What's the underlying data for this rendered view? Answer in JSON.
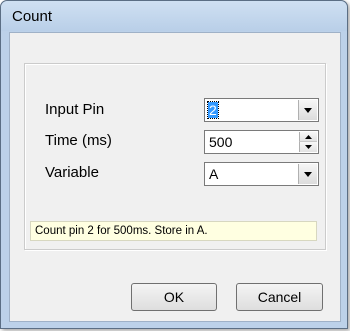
{
  "dialog": {
    "title": "Count"
  },
  "form": {
    "input_pin": {
      "label": "Input Pin",
      "value": "2"
    },
    "time": {
      "label": "Time (ms)",
      "value": "500"
    },
    "variable": {
      "label": "Variable",
      "value": "A"
    }
  },
  "summary": "Count pin 2 for 500ms. Store in A.",
  "buttons": {
    "ok": "OK",
    "cancel": "Cancel"
  },
  "colors": {
    "frame": "#bcd1e9",
    "summary_background": "#ffffe1",
    "selection": "#3399ff"
  },
  "icons": {
    "dropdown": "chevron-down-icon",
    "spin_up": "spin-up-icon",
    "spin_down": "spin-down-icon"
  }
}
